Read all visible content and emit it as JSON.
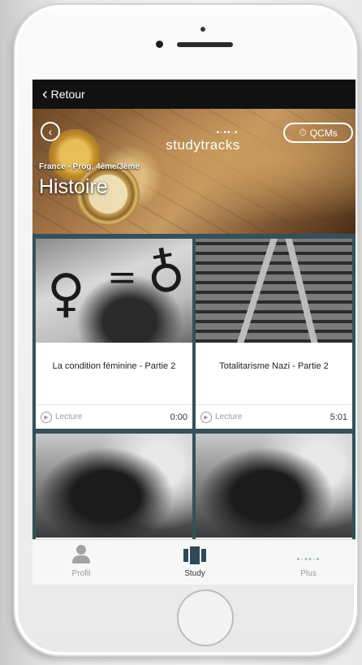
{
  "navbar": {
    "back_label": "Retour"
  },
  "hero": {
    "brand": "studytracks",
    "qcm_label": "QCMs",
    "subtitle": "France - Prog. 4ème/3ème",
    "title": "Histoire"
  },
  "cards": [
    {
      "title": "La condition féminine - Partie 2",
      "action": "Lecture",
      "duration": "0:00"
    },
    {
      "title": "Totalitarisme Nazi - Partie 2",
      "action": "Lecture",
      "duration": "5:01"
    },
    {
      "title": "",
      "action": "",
      "duration": ""
    },
    {
      "title": "",
      "action": "",
      "duration": ""
    }
  ],
  "tabs": [
    {
      "label": "Profil",
      "icon": "person-icon"
    },
    {
      "label": "Study",
      "icon": "study-icon"
    },
    {
      "label": "Plus",
      "icon": "dots-icon"
    }
  ],
  "colors": {
    "accent": "#2e4a56",
    "navbar": "#111111",
    "grid_bg": "#35505a"
  }
}
